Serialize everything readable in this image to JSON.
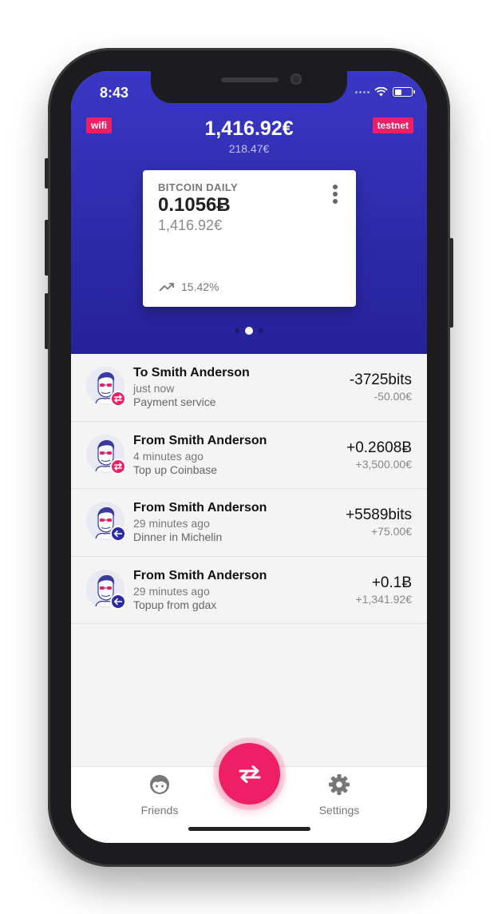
{
  "status_bar": {
    "time": "8:43"
  },
  "header": {
    "left_tag": "wifi",
    "right_tag": "testnet",
    "balance": "1,416.92€",
    "secondary_balance": "218.47€"
  },
  "wallet_card": {
    "title": "BITCOIN DAILY",
    "amount": "0.1056Ƀ",
    "fiat": "1,416.92€",
    "trend": "15.42%"
  },
  "pager": {
    "pages": 3,
    "active": 2
  },
  "transactions": [
    {
      "name": "To Smith Anderson",
      "time": "just now",
      "description": "Payment service",
      "amount": "-3725bits",
      "fiat": "-50.00€",
      "badge": "exchange-icon"
    },
    {
      "name": "From Smith Anderson",
      "time": "4 minutes ago",
      "description": "Top up Coinbase",
      "amount": "+0.2608Ƀ",
      "fiat": "+3,500.00€",
      "badge": "exchange-icon"
    },
    {
      "name": "From Smith Anderson",
      "time": "29 minutes ago",
      "description": "Dinner in Michelin",
      "amount": "+5589bits",
      "fiat": "+75.00€",
      "badge": "arrow-left-icon"
    },
    {
      "name": "From Smith Anderson",
      "time": "29 minutes ago",
      "description": "Topup from gdax",
      "amount": "+0.1Ƀ",
      "fiat": "+1,341.92€",
      "badge": "arrow-left-icon"
    }
  ],
  "tab_bar": {
    "friends_label": "Friends",
    "settings_label": "Settings",
    "friends_icon": "face-icon",
    "settings_icon": "gear-icon",
    "fab_icon": "exchange-arrows-icon"
  },
  "colors": {
    "primary": "#2d2aa8",
    "accent": "#ee1f66",
    "list_background": "#f4f4f4"
  }
}
